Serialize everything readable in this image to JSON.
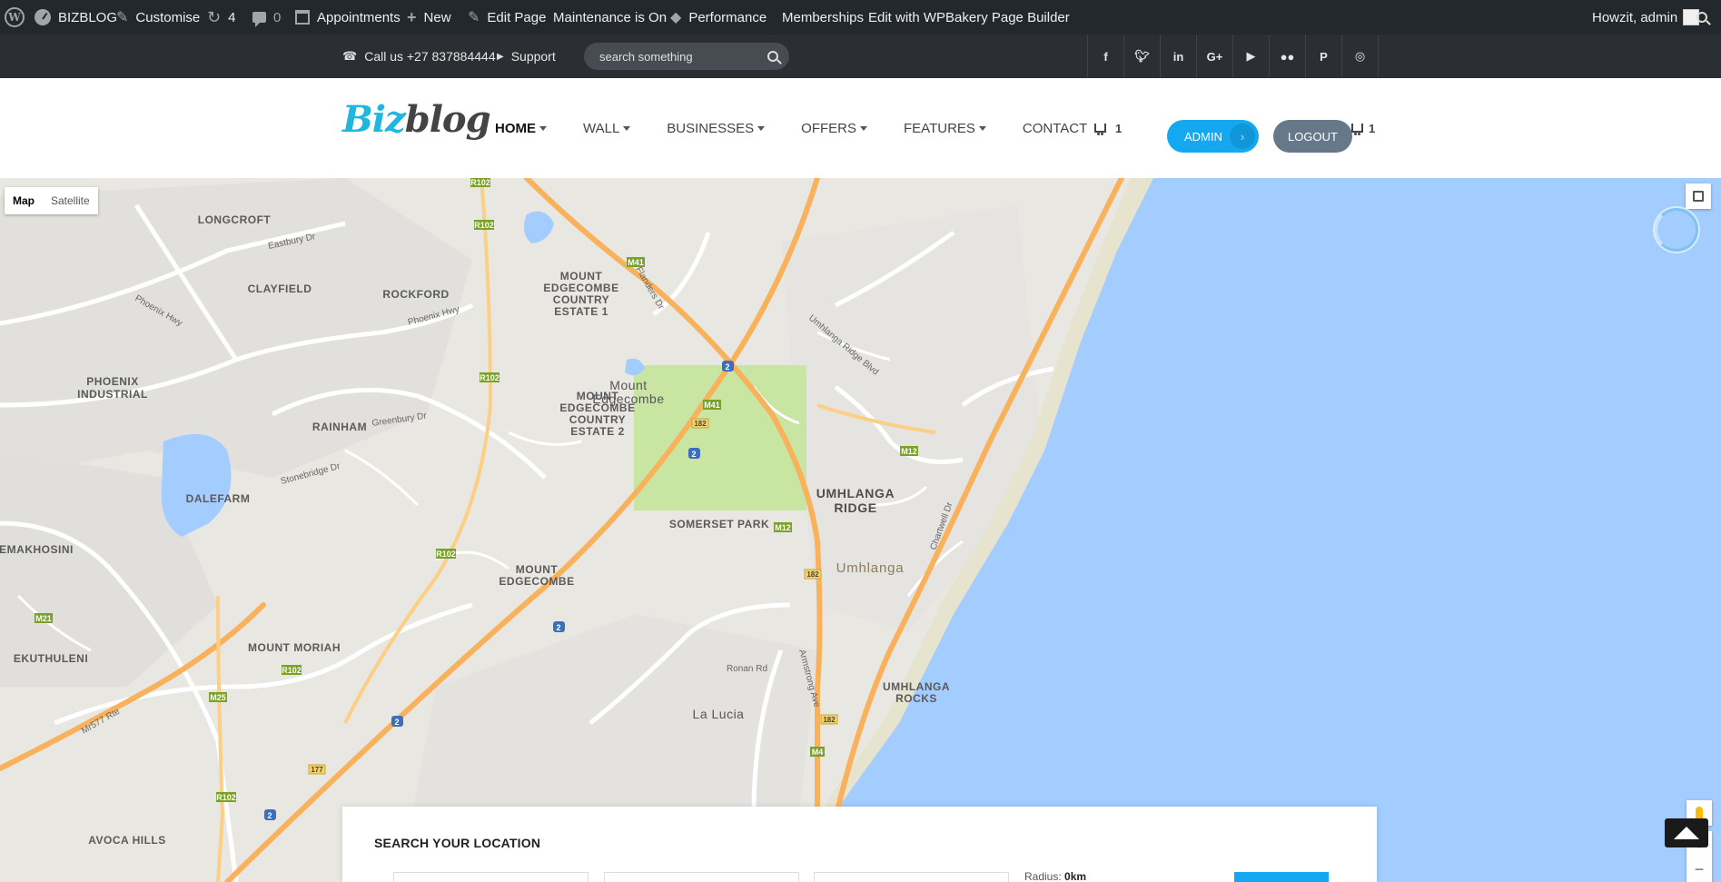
{
  "admin_bar": {
    "site_name": "BIZBLOG",
    "customise": "Customise",
    "updates_count": "4",
    "comments_count": "0",
    "appointments": "Appointments",
    "new": "New",
    "edit_page": "Edit Page",
    "maintenance": "Maintenance is On",
    "performance": "Performance",
    "memberships": "Memberships",
    "wpbakery": "Edit with WPBakery Page Builder",
    "howdy": "Howzit, admin"
  },
  "topbar": {
    "phone": "Call us +27 837884444",
    "support": "Support",
    "search_placeholder": "search something",
    "socials": [
      "facebook-icon",
      "twitter-icon",
      "linkedin-icon",
      "google-plus-icon",
      "youtube-icon",
      "flickr-icon",
      "pinterest-icon",
      "instagram-icon"
    ]
  },
  "header": {
    "logo_part1": "Biz",
    "logo_part2": "blog",
    "nav": [
      {
        "label": "HOME",
        "dropdown": true,
        "active": true
      },
      {
        "label": "WALL",
        "dropdown": true
      },
      {
        "label": "BUSINESSES",
        "dropdown": true
      },
      {
        "label": "OFFERS",
        "dropdown": true
      },
      {
        "label": "FEATURES",
        "dropdown": true
      },
      {
        "label": "CONTACT",
        "dropdown": false
      }
    ],
    "cart_count": "1",
    "admin_button": "ADMIN",
    "logout_button": "LOGOUT",
    "cart2_count": "1"
  },
  "map": {
    "type_map": "Map",
    "type_satellite": "Satellite",
    "labels": {
      "longcroft": "LONGCROFT",
      "clayfield": "CLAYFIELD",
      "rockford": "ROCKFORD",
      "phoenix_ind1": "PHOENIX",
      "phoenix_ind2": "INDUSTRIAL",
      "rainham": "RAINHAM",
      "dalefarm": "DALEFARM",
      "emakhosini": "EMAKHOSINI",
      "ekuthuleni": "EKUTHULENI",
      "mount_moriah": "MOUNT MORIAH",
      "avoca_hills": "AVOCA HILLS",
      "mecc1_a": "MOUNT",
      "mecc1_b": "EDGECOMBE",
      "mecc1_c": "COUNTRY",
      "mecc1_d": "ESTATE 1",
      "mount_edgecombe_a": "Mount",
      "mount_edgecombe_b": "Edgecombe",
      "mecc2_a": "MOUNT",
      "mecc2_b": "EDGECOMBE",
      "mecc2_c": "COUNTRY",
      "mecc2_d": "ESTATE 2",
      "somerset_park": "SOMERSET PARK",
      "me_south_a": "MOUNT",
      "me_south_b": "EDGECOMBE",
      "umhlanga_ridge_a": "UMHLANGA",
      "umhlanga_ridge_b": "RIDGE",
      "umhlanga": "Umhlanga",
      "umhlanga_rocks_a": "UMHLANGA",
      "umhlanga_rocks_b": "ROCKS",
      "la_lucia": "La Lucia",
      "eastbury_dr": "Eastbury Dr",
      "phoenix_hwy": "Phoenix Hwy",
      "phoenix_hwy2": "Phoenix Hwy",
      "mr577": "Mr577 Rte",
      "flanders_dr": "Flanders Dr",
      "umhlanga_ridge_blvd": "Umhlanga Ridge Blvd",
      "armstrong_ave": "Armstrong Ave",
      "chartwell_dr": "Chartwell Dr",
      "ronan_rd": "Ronan Rd",
      "greenbury_dr": "Greenbury Dr",
      "stonebridge_dr": "Stonebridge Dr"
    },
    "shields": {
      "r102a": "R102",
      "r102b": "R102",
      "r102c": "R102",
      "r102d": "R102",
      "r102e": "R102",
      "r102f": "R102",
      "m41a": "M41",
      "m41b": "M41",
      "m12a": "M12",
      "m12b": "M12",
      "m21": "M21",
      "m25": "M25",
      "m4": "M4",
      "n2a": "2",
      "n2b": "2",
      "n2c": "2",
      "n2d": "2",
      "n2e": "2",
      "r182a": "182",
      "r182b": "182",
      "r182c": "182",
      "r177": "177"
    }
  },
  "search_panel": {
    "title": "SEARCH YOUR LOCATION",
    "radius_label": "Radius:",
    "radius_value": "0km"
  },
  "colors": {
    "accent": "#14a8f0",
    "logout": "#667889",
    "admin_bar": "#23282d",
    "topbar": "#2b2f33",
    "water": "#a3ccff",
    "park": "#c8e5a2"
  }
}
